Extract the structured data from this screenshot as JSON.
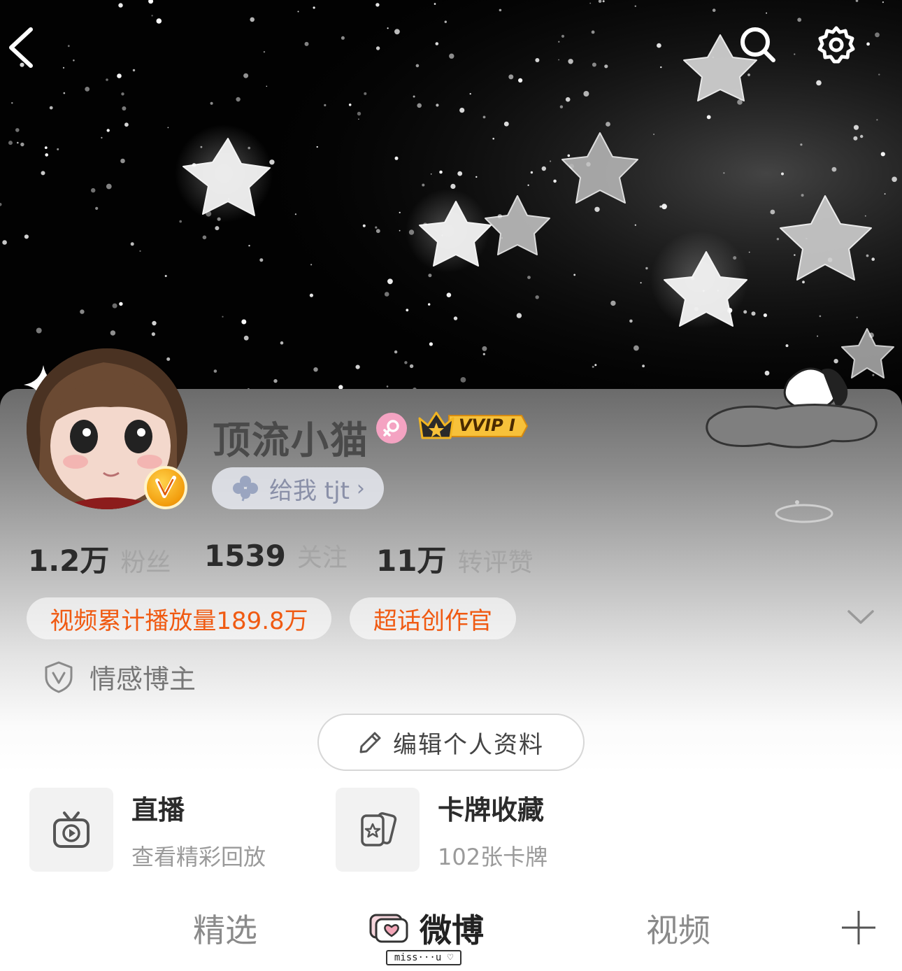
{
  "header": {
    "back_icon": "back-chevron-icon",
    "search_icon": "search-icon",
    "settings_icon": "gear-icon"
  },
  "profile": {
    "nickname": "顶流小猫",
    "gender_icon": "female-icon",
    "vip_badge": "VVIP I",
    "tag_label": "给我 tjt",
    "tag_icon": "clover-icon",
    "tag_chevron": "›"
  },
  "stats": [
    {
      "value": "1.2万",
      "label": "粉丝"
    },
    {
      "value": "1539",
      "label": "关注"
    },
    {
      "value": "11万",
      "label": "转评赞"
    }
  ],
  "badges": [
    {
      "label": "视频累计播放量189.8万"
    },
    {
      "label": "超话创作官"
    }
  ],
  "category": {
    "label": "情感博主",
    "icon": "verified-shield-icon"
  },
  "edit_button": {
    "label": "编辑个人资料",
    "icon": "pencil-icon"
  },
  "cards": [
    {
      "title": "直播",
      "subtitle": "查看精彩回放",
      "icon": "tv-play-icon"
    },
    {
      "title": "卡牌收藏",
      "subtitle": "102张卡牌",
      "icon": "card-star-icon"
    }
  ],
  "tabs": [
    {
      "label": "精选"
    },
    {
      "label": "微博",
      "active": true
    },
    {
      "label": "视频"
    }
  ],
  "tab_sticker": "miss···u ♡",
  "colors": {
    "accent": "#f05a12",
    "text_dark": "#2b2b2b",
    "text_muted": "#a5a5a5"
  }
}
